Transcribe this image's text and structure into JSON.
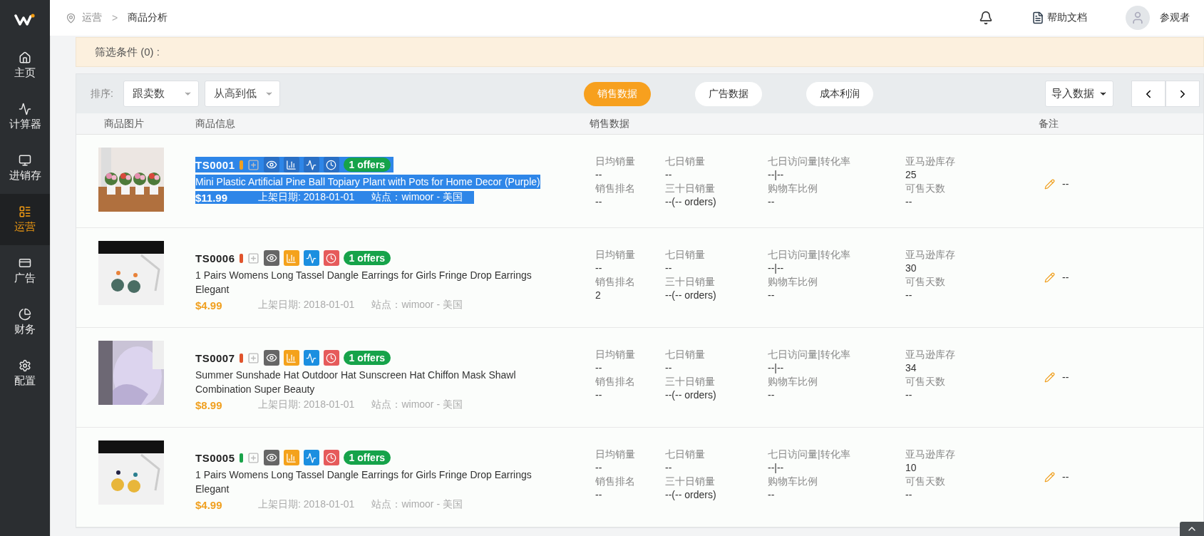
{
  "sidebar": {
    "items": [
      {
        "label": "主页",
        "selected": false
      },
      {
        "label": "计算器",
        "selected": false
      },
      {
        "label": "进销存",
        "selected": false
      },
      {
        "label": "运营",
        "selected": true
      },
      {
        "label": "广告",
        "selected": false
      },
      {
        "label": "财务",
        "selected": false
      },
      {
        "label": "配置",
        "selected": false
      }
    ]
  },
  "breadcrumb": {
    "items": [
      "运营",
      "商品分析"
    ],
    "separator": ">"
  },
  "header": {
    "help": "帮助文档",
    "user": "参观者"
  },
  "filter": {
    "label": "筛选条件 (0) :"
  },
  "toolbar": {
    "sort_label": "排序:",
    "selects": [
      {
        "value": "跟卖数"
      },
      {
        "value": "从高到低"
      }
    ],
    "view_tabs": [
      {
        "label": "销售数据",
        "selected": true
      },
      {
        "label": "广告数据",
        "selected": false
      },
      {
        "label": "成本利润",
        "selected": false
      }
    ],
    "import_button": "导入数据"
  },
  "table": {
    "columns": [
      "商品图片",
      "商品信息",
      "销售数据",
      "备注"
    ],
    "rows": [
      {
        "sku": "TS0001",
        "color": "#f0a020",
        "offers": "1 offers",
        "highlighted": true,
        "title": "Mini Plastic Artificial Pine Ball Topiary Plant with Pots for Home Decor (Purple)",
        "price": "$11.99",
        "date": "上架日期: 2018-01-01",
        "site": "站点：wimoor - 美国",
        "kind": "picture",
        "stats": [
          [
            {
              "label": "日均销量",
              "value": "--"
            },
            {
              "label": "销售排名",
              "value": "--"
            }
          ],
          [
            {
              "label": "七日销量",
              "value": "--"
            },
            {
              "label": "三十日销量",
              "value": "--(-- orders)"
            }
          ],
          [
            {
              "label": "七日访问量|转化率",
              "value": "--|--"
            },
            {
              "label": "购物车比例",
              "value": "--"
            }
          ],
          [
            {
              "label": "亚马逊库存",
              "value": "25"
            },
            {
              "label": "可售天数",
              "value": "--"
            }
          ]
        ],
        "note": "--"
      },
      {
        "sku": "TS0006",
        "color": "#e0542c",
        "offers": "1 offers",
        "highlighted": false,
        "title": "1 Pairs Womens Long Tassel Dangle Earrings for Girls Fringe Drop Earrings Elegant",
        "price": "$4.99",
        "date": "上架日期: 2018-01-01",
        "site": "站点：wimoor - 美国",
        "kind": "picture",
        "stats": [
          [
            {
              "label": "日均销量",
              "value": "--"
            },
            {
              "label": "销售排名",
              "value": "2"
            }
          ],
          [
            {
              "label": "七日销量",
              "value": "--"
            },
            {
              "label": "三十日销量",
              "value": "--(-- orders)"
            }
          ],
          [
            {
              "label": "七日访问量|转化率",
              "value": "--|--"
            },
            {
              "label": "购物车比例",
              "value": "--"
            }
          ],
          [
            {
              "label": "亚马逊库存",
              "value": "30"
            },
            {
              "label": "可售天数",
              "value": "--"
            }
          ]
        ],
        "note": "--"
      },
      {
        "sku": "TS0007",
        "color": "#e0542c",
        "offers": "1 offers",
        "highlighted": false,
        "title": "Summer Sunshade Hat Outdoor Hat Sunscreen Hat Chiffon Mask Shawl Combination Super Beauty",
        "price": "$8.99",
        "date": "上架日期: 2018-01-01",
        "site": "站点：wimoor - 美国",
        "kind": "picture",
        "stats": [
          [
            {
              "label": "日均销量",
              "value": "--"
            },
            {
              "label": "销售排名",
              "value": "--"
            }
          ],
          [
            {
              "label": "七日销量",
              "value": "--"
            },
            {
              "label": "三十日销量",
              "value": "--(-- orders)"
            }
          ],
          [
            {
              "label": "七日访问量|转化率",
              "value": "--|--"
            },
            {
              "label": "购物车比例",
              "value": "--"
            }
          ],
          [
            {
              "label": "亚马逊库存",
              "value": "34"
            },
            {
              "label": "可售天数",
              "value": "--"
            }
          ]
        ],
        "note": "--"
      },
      {
        "sku": "TS0005",
        "color": "#1aa34a",
        "offers": "1 offers",
        "highlighted": false,
        "title": "1 Pairs Womens Long Tassel Dangle Earrings for Girls Fringe Drop Earrings Elegant",
        "price": "$4.99",
        "date": "上架日期: 2018-01-01",
        "site": "站点：wimoor - 美国",
        "kind": "picture",
        "stats": [
          [
            {
              "label": "日均销量",
              "value": "--"
            },
            {
              "label": "销售排名",
              "value": "--"
            }
          ],
          [
            {
              "label": "七日销量",
              "value": "--"
            },
            {
              "label": "三十日销量",
              "value": "--(-- orders)"
            }
          ],
          [
            {
              "label": "七日访问量|转化率",
              "value": "--|--"
            },
            {
              "label": "购物车比例",
              "value": "--"
            }
          ],
          [
            {
              "label": "亚马逊库存",
              "value": "10"
            },
            {
              "label": "可售天数",
              "value": "--"
            }
          ]
        ],
        "note": "--"
      }
    ]
  }
}
